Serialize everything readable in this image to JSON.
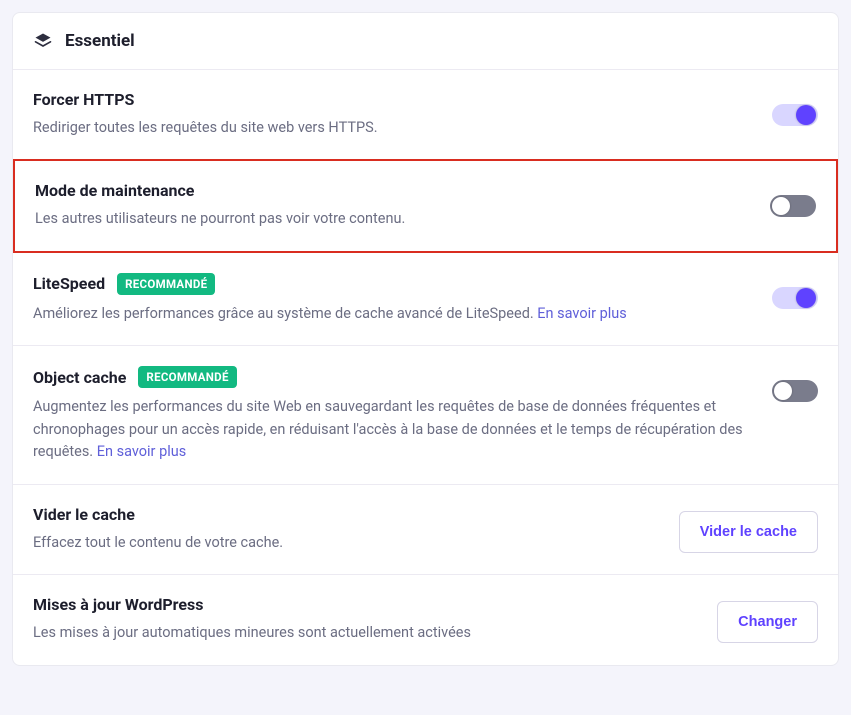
{
  "header": {
    "title": "Essentiel"
  },
  "badges": {
    "recommended": "RECOMMANDÉ"
  },
  "sections": {
    "https": {
      "heading": "Forcer HTTPS",
      "desc": "Rediriger toutes les requêtes du site web vers HTTPS."
    },
    "maintenance": {
      "heading": "Mode de maintenance",
      "desc": "Les autres utilisateurs ne pourront pas voir votre contenu."
    },
    "litespeed": {
      "heading": "LiteSpeed",
      "desc": "Améliorez les performances grâce au système de cache avancé de LiteSpeed. ",
      "link": "En savoir plus"
    },
    "objectcache": {
      "heading": "Object cache",
      "desc": "Augmentez les performances du site Web en sauvegardant les requêtes de base de données fréquentes et chronophages pour un accès rapide, en réduisant l'accès à la base de données et le temps de récupération des requêtes. ",
      "link": "En savoir plus"
    },
    "clearcache": {
      "heading": "Vider le cache",
      "desc": "Effacez tout le contenu de votre cache.",
      "button": "Vider le cache"
    },
    "wpupdates": {
      "heading": "Mises à jour WordPress",
      "desc": "Les mises à jour automatiques mineures sont actuellement activées",
      "button": "Changer"
    }
  }
}
